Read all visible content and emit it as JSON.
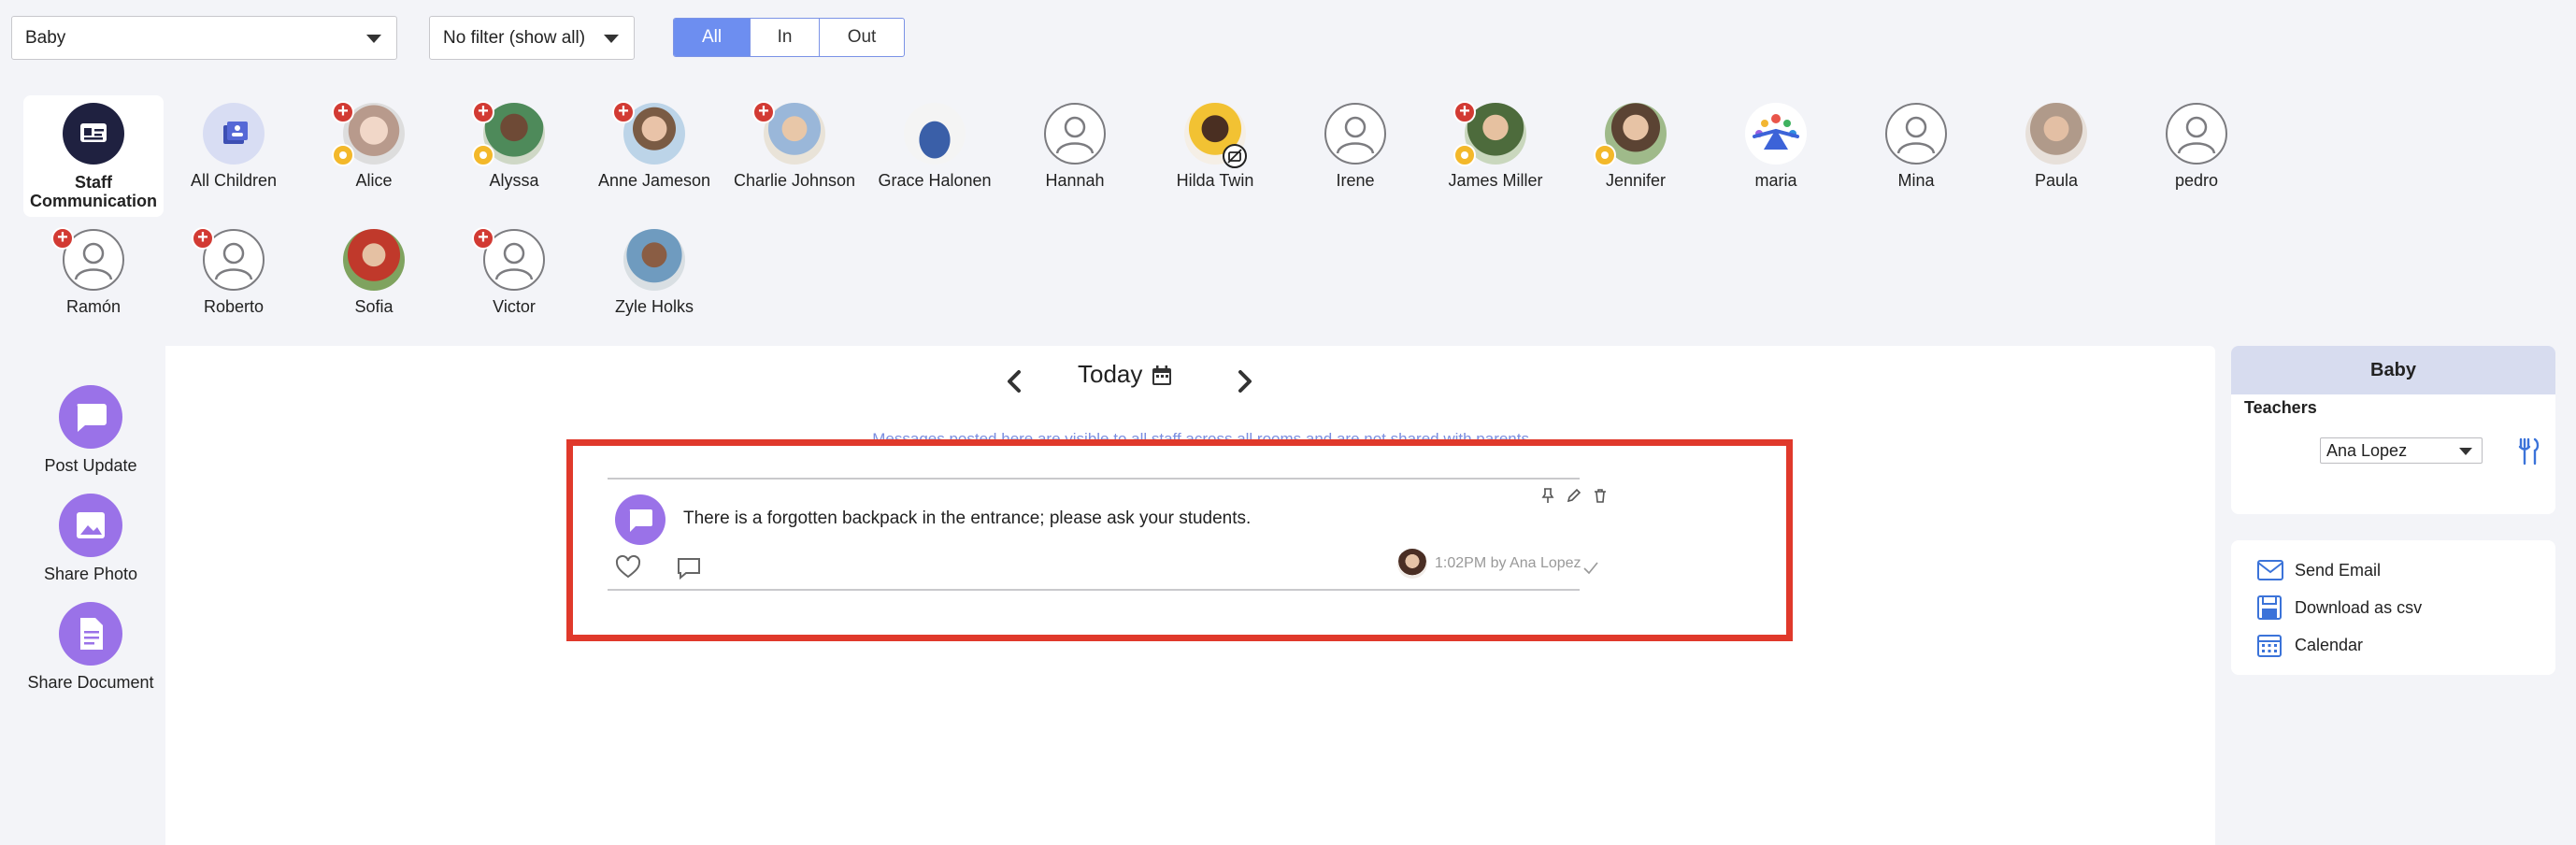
{
  "filters": {
    "room": "Baby",
    "status_filter": "No filter (show all)",
    "segments": [
      "All",
      "In",
      "Out"
    ],
    "active_segment": "All"
  },
  "children": [
    {
      "name": "Staff Communication",
      "kind": "staff",
      "selected": true
    },
    {
      "name": "All Children",
      "kind": "all"
    },
    {
      "name": "Alice",
      "kind": "photo",
      "red": true,
      "yellow": true
    },
    {
      "name": "Alyssa",
      "kind": "photo",
      "red": true,
      "yellow": true
    },
    {
      "name": "Anne Jameson",
      "kind": "photo",
      "red": true
    },
    {
      "name": "Charlie Johnson",
      "kind": "photo",
      "red": true
    },
    {
      "name": "Grace Halonen",
      "kind": "photo"
    },
    {
      "name": "Hannah",
      "kind": "placeholder"
    },
    {
      "name": "Hilda Twin",
      "kind": "photo",
      "nophoto": true
    },
    {
      "name": "Irene",
      "kind": "placeholder"
    },
    {
      "name": "James Miller",
      "kind": "photo",
      "red": true,
      "yellow": true
    },
    {
      "name": "Jennifer",
      "kind": "photo",
      "yellow": true
    },
    {
      "name": "maria",
      "kind": "logo"
    },
    {
      "name": "Mina",
      "kind": "placeholder"
    },
    {
      "name": "Paula",
      "kind": "photo"
    },
    {
      "name": "pedro",
      "kind": "placeholder"
    },
    {
      "name": "Ramón",
      "kind": "placeholder",
      "red": true
    },
    {
      "name": "Roberto",
      "kind": "placeholder",
      "red": true
    },
    {
      "name": "Sofia",
      "kind": "photo"
    },
    {
      "name": "Victor",
      "kind": "placeholder",
      "red": true
    },
    {
      "name": "Zyle Holks",
      "kind": "photo"
    }
  ],
  "actions": {
    "post_update": "Post Update",
    "share_photo": "Share Photo",
    "share_document": "Share Document"
  },
  "date_nav": {
    "label": "Today"
  },
  "notice": "Messages posted here are visible to all staff across all rooms and are not shared with parents.",
  "post": {
    "text": "There is a forgotten backpack in the entrance; please ask your students.",
    "meta": "1:02PM by Ana Lopez"
  },
  "room_card": {
    "title": "Baby",
    "teachers_label": "Teachers",
    "teacher": "Ana Lopez"
  },
  "links": {
    "send_email": "Send Email",
    "download_csv": "Download as csv",
    "calendar": "Calendar"
  },
  "colors": {
    "accent": "#6d8ef0",
    "purple": "#9a72e8",
    "highlight": "#e0392b"
  }
}
